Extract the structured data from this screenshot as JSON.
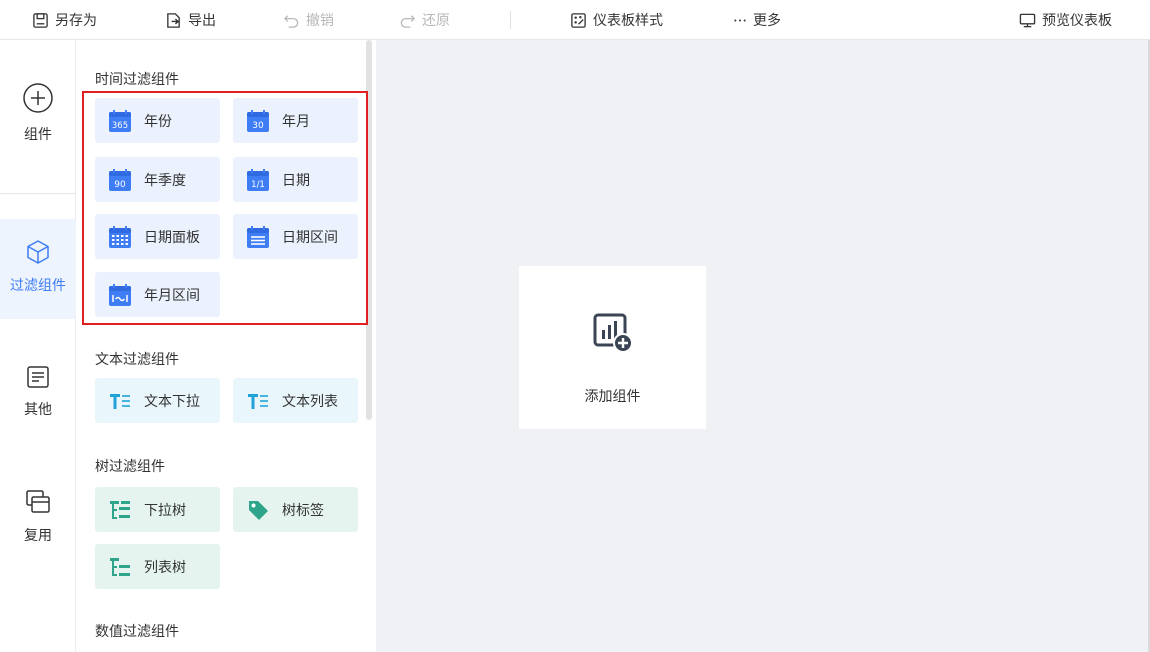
{
  "toolbar": {
    "save_as": "另存为",
    "export": "导出",
    "undo": "撤销",
    "redo": "还原",
    "dashboard_style": "仪表板样式",
    "more": "更多",
    "preview": "预览仪表板"
  },
  "rail": {
    "items": [
      {
        "label": "组件",
        "icon": "plus-circle-icon"
      },
      {
        "label": "过滤组件",
        "icon": "cube-icon",
        "active": true
      },
      {
        "label": "其他",
        "icon": "document-icon"
      },
      {
        "label": "复用",
        "icon": "copy-stack-icon"
      }
    ]
  },
  "panel": {
    "time_section": {
      "title": "时间过滤组件",
      "items": [
        {
          "label": "年份",
          "icon": "calendar-365-icon"
        },
        {
          "label": "年月",
          "icon": "calendar-30-icon"
        },
        {
          "label": "年季度",
          "icon": "calendar-90-icon"
        },
        {
          "label": "日期",
          "icon": "calendar-1-1-icon"
        },
        {
          "label": "日期面板",
          "icon": "calendar-grid-icon"
        },
        {
          "label": "日期区间",
          "icon": "calendar-lines-icon"
        },
        {
          "label": "年月区间",
          "icon": "calendar-range-icon"
        }
      ]
    },
    "text_section": {
      "title": "文本过滤组件",
      "items": [
        {
          "label": "文本下拉",
          "icon": "text-dropdown-icon"
        },
        {
          "label": "文本列表",
          "icon": "text-list-icon"
        }
      ]
    },
    "tree_section": {
      "title": "树过滤组件",
      "items": [
        {
          "label": "下拉树",
          "icon": "tree-dropdown-icon"
        },
        {
          "label": "树标签",
          "icon": "tag-icon"
        },
        {
          "label": "列表树",
          "icon": "tree-list-icon"
        }
      ]
    },
    "number_section": {
      "title": "数值过滤组件"
    }
  },
  "canvas": {
    "add_label": "添加组件"
  },
  "colors": {
    "accent": "#3f7df4",
    "time_card_bg": "#ebf2fd",
    "text_card_bg": "#e9f6fb",
    "tree_card_bg": "#e5f4ef",
    "highlight_border": "#e02020"
  }
}
